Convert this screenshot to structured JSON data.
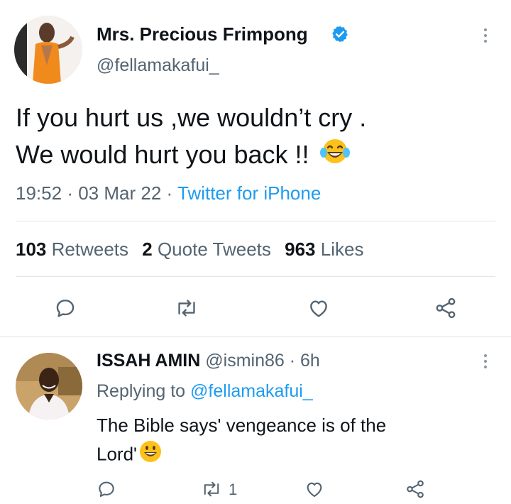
{
  "tweet": {
    "author_name": "Mrs. Precious Frimpong",
    "author_handle": "@fellamakafui_",
    "text_line1": "If you hurt us ,we wouldn’t cry .",
    "text_line2": "We would hurt you back !!",
    "time": "19:52",
    "date": "03 Mar 22",
    "separator": "·",
    "source": "Twitter for iPhone",
    "retweets_count": "103",
    "retweets_label": "Retweets",
    "quotes_count": "2",
    "quotes_label": "Quote Tweets",
    "likes_count": "963",
    "likes_label": "Likes",
    "emoji": "face-with-tears-of-joy"
  },
  "reply": {
    "author_name": "ISSAH AMIN",
    "author_handle": "@ismin86",
    "separator": "·",
    "age": "6h",
    "replying_prefix": "Replying to",
    "replying_to": "@fellamakafui_",
    "text_line1": "The Bible says' vengeance is of the",
    "text_line2": "Lord'",
    "retweet_count": "1",
    "emoji": "grinning-face"
  },
  "icons": {
    "verified": "verified-badge-icon",
    "reply": "reply-icon",
    "retweet": "retweet-icon",
    "like": "heart-icon",
    "share": "share-icon",
    "more": "more-icon"
  },
  "colors": {
    "accent": "#1d9bf0",
    "text": "#0f1419",
    "muted": "#536471",
    "divider": "#e1e6ea"
  }
}
